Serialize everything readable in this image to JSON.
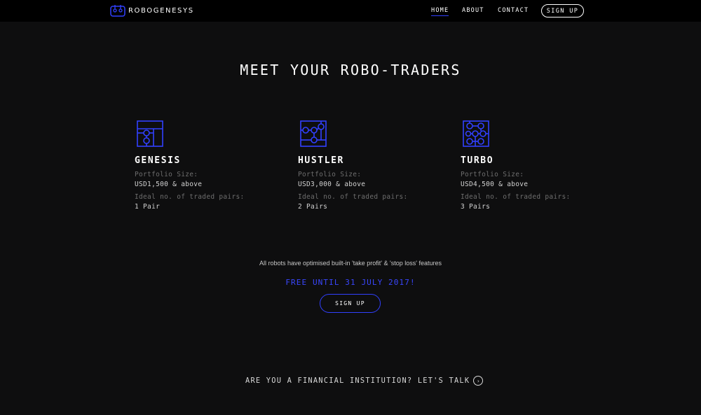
{
  "brand": {
    "name": "ROBOGENESYS",
    "accent_color": "#3140ff"
  },
  "nav": {
    "items": [
      {
        "label": "HOME",
        "active": true
      },
      {
        "label": "ABOUT",
        "active": false
      },
      {
        "label": "CONTACT",
        "active": false
      }
    ],
    "signup_label": "SIGN UP"
  },
  "main": {
    "title": "MEET YOUR ROBO-TRADERS",
    "robots": [
      {
        "name": "GENESIS",
        "icon": "genesis-circuit-icon",
        "portfolio_label": "Portfolio Size:",
        "portfolio_value": "USD1,500 & above",
        "pairs_label": "Ideal no. of traded pairs:",
        "pairs_value": "1 Pair"
      },
      {
        "name": "HUSTLER",
        "icon": "hustler-circuit-icon",
        "portfolio_label": "Portfolio Size:",
        "portfolio_value": "USD3,000 & above",
        "pairs_label": "Ideal no. of traded pairs:",
        "pairs_value": "2 Pairs"
      },
      {
        "name": "TURBO",
        "icon": "turbo-circuit-icon",
        "portfolio_label": "Portfolio Size:",
        "portfolio_value": "USD4,500 & above",
        "pairs_label": "Ideal no. of traded pairs:",
        "pairs_value": "3 Pairs"
      }
    ]
  },
  "cta": {
    "features_note": "All robots have optimised built-in 'take profit' & 'stop loss' features",
    "promo": "FREE UNTIL 31 JULY 2017!",
    "signup_label": "SIGN UP"
  },
  "footer_link": {
    "label": "ARE YOU A FINANCIAL INSTITUTION? LET'S TALK",
    "icon": "chevron-right-icon"
  }
}
